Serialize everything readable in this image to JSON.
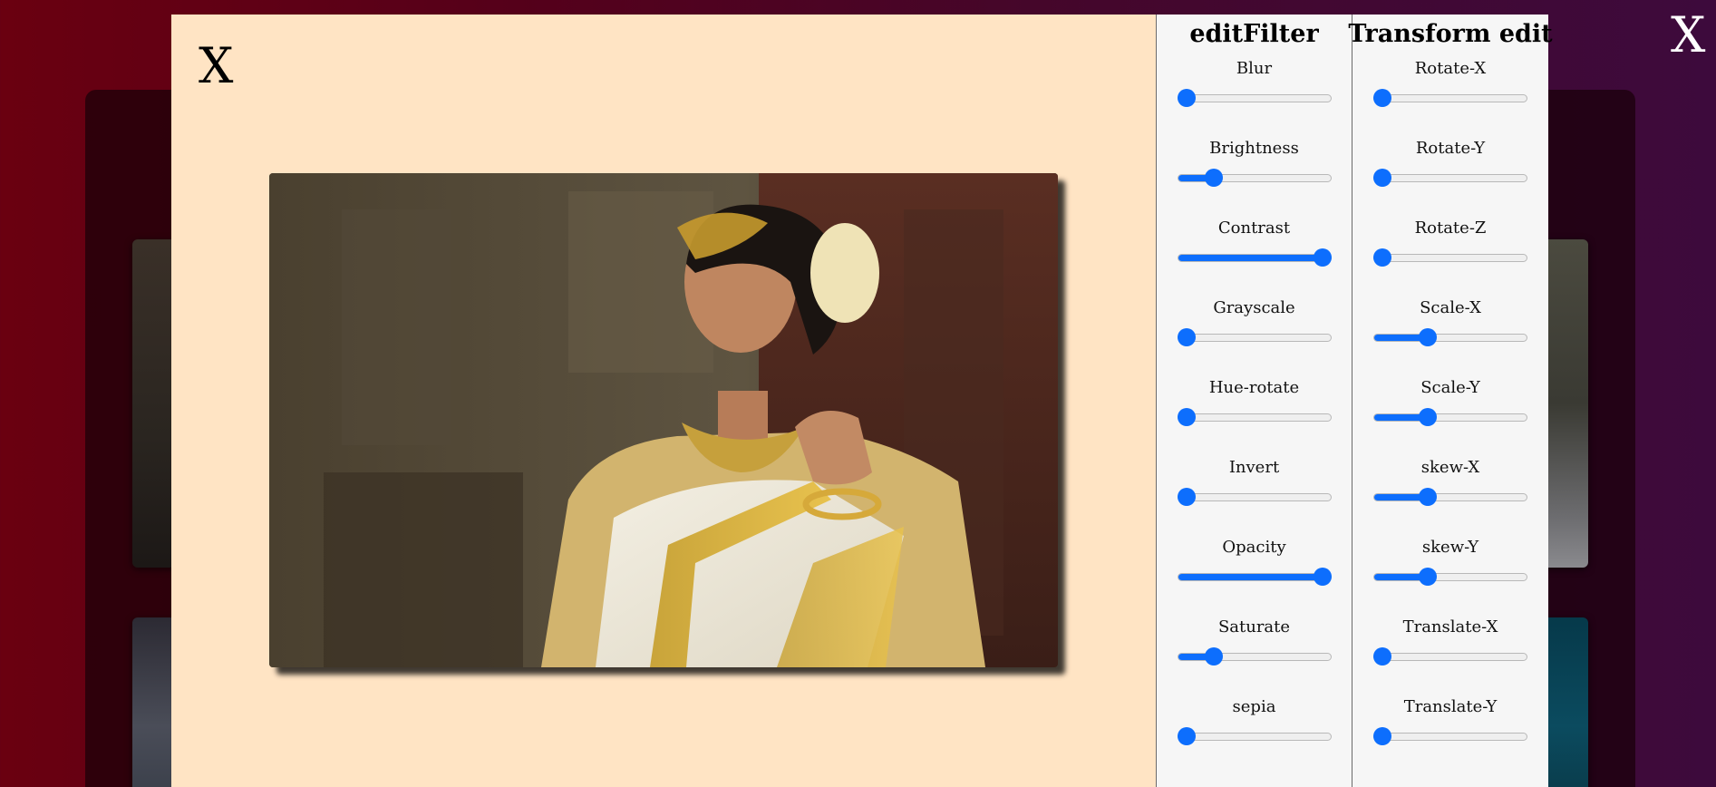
{
  "background_window": {
    "close_label": "X"
  },
  "preview": {
    "close_label": "X",
    "image_alt": "Woman in traditional saree with gold jewelry"
  },
  "filter_panel": {
    "title": "editFilter",
    "controls": [
      {
        "label": "Blur",
        "value": 0
      },
      {
        "label": "Brightness",
        "value": 0.2
      },
      {
        "label": "Contrast",
        "value": 1
      },
      {
        "label": "Grayscale",
        "value": 0
      },
      {
        "label": "Hue-rotate",
        "value": 0
      },
      {
        "label": "Invert",
        "value": 0
      },
      {
        "label": "Opacity",
        "value": 1
      },
      {
        "label": "Saturate",
        "value": 0.2
      },
      {
        "label": "sepia",
        "value": 0
      }
    ]
  },
  "transform_panel": {
    "title": "Transform edit",
    "controls": [
      {
        "label": "Rotate-X",
        "value": 0
      },
      {
        "label": "Rotate-Y",
        "value": 0
      },
      {
        "label": "Rotate-Z",
        "value": 0
      },
      {
        "label": "Scale-X",
        "value": 0.33
      },
      {
        "label": "Scale-Y",
        "value": 0.33
      },
      {
        "label": "skew-X",
        "value": 0.33
      },
      {
        "label": "skew-Y",
        "value": 0.33
      },
      {
        "label": "Translate-X",
        "value": 0
      },
      {
        "label": "Translate-Y",
        "value": 0
      }
    ]
  },
  "colors": {
    "accent": "#0d6efd",
    "preview_bg": "#ffe4c4",
    "panel_bg": "#f6f6f6"
  }
}
